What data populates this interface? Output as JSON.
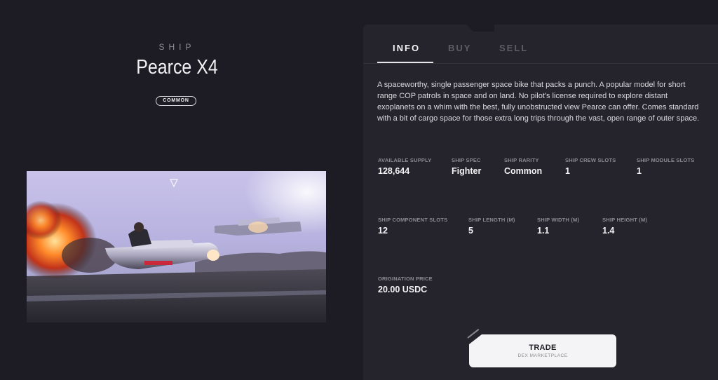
{
  "ship": {
    "kicker": "SHIP",
    "name": "Pearce X4",
    "rarity_badge": "COMMON"
  },
  "tabs": [
    {
      "label": "INFO",
      "active": true
    },
    {
      "label": "BUY",
      "active": false
    },
    {
      "label": "SELL",
      "active": false
    }
  ],
  "description": "A spaceworthy, single passenger space bike that packs a punch. A popular model for short range COP patrols in space and on land. No pilot's license required to explore distant exoplanets on a whim with the best, fully unobstructed view Pearce can offer. Comes standard with a bit of cargo space for those extra long trips through the vast, open range of outer space.",
  "stats": {
    "available_supply": {
      "label": "AVAILABLE SUPPLY",
      "value": "128,644"
    },
    "ship_spec": {
      "label": "SHIP SPEC",
      "value": "Fighter"
    },
    "ship_rarity": {
      "label": "SHIP RARITY",
      "value": "Common"
    },
    "crew_slots": {
      "label": "SHIP CREW SLOTS",
      "value": "1"
    },
    "module_slots": {
      "label": "SHIP MODULE SLOTS",
      "value": "1"
    },
    "component_slots": {
      "label": "SHIP COMPONENT SLOTS",
      "value": "12"
    },
    "length": {
      "label": "SHIP LENGTH (M)",
      "value": "5"
    },
    "width": {
      "label": "SHIP WIDTH (M)",
      "value": "1.1"
    },
    "height": {
      "label": "SHIP HEIGHT (M)",
      "value": "1.4"
    },
    "origination_price": {
      "label": "ORIGINATION PRICE",
      "value": "20.00 USDC"
    }
  },
  "trade": {
    "title": "TRADE",
    "subtitle": "DEX MARKETPLACE"
  },
  "colors": {
    "background": "#1d1c24",
    "panel": "#25242c",
    "accent_text": "#f3f3f6",
    "muted_text": "#8c8b95"
  }
}
